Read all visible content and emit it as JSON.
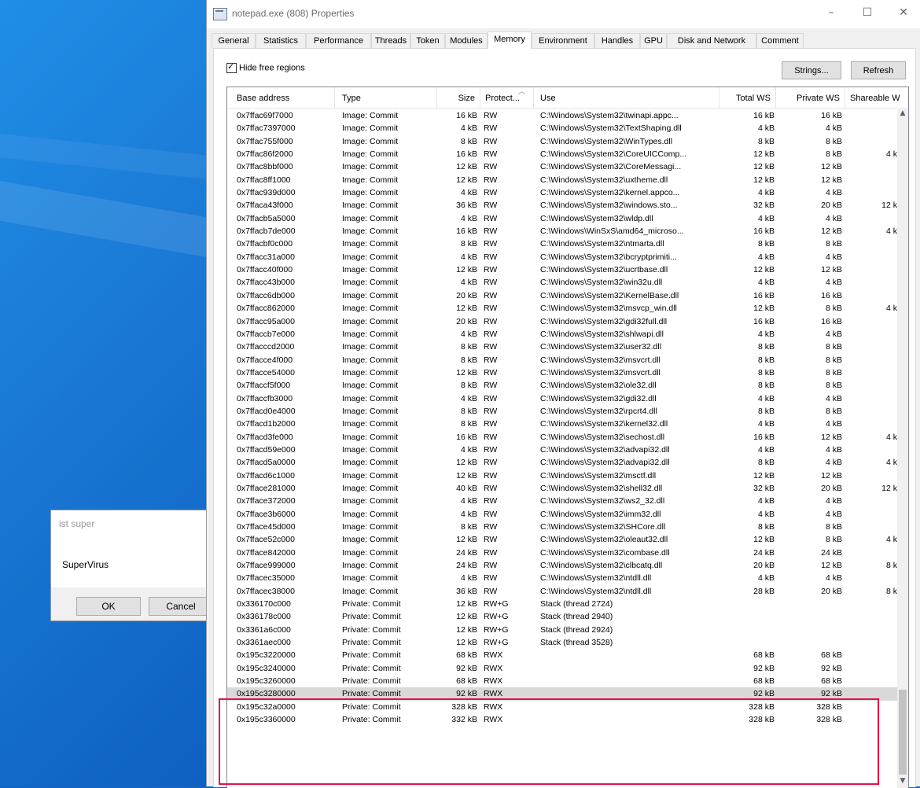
{
  "window": {
    "title": "notepad.exe (808) Properties",
    "tabs": [
      "General",
      "Statistics",
      "Performance",
      "Threads",
      "Token",
      "Modules",
      "Memory",
      "Environment",
      "Handles",
      "GPU",
      "Disk and Network",
      "Comment"
    ],
    "active_tab": "Memory"
  },
  "toolbar": {
    "hide_free_label": "Hide free regions",
    "hide_free_checked": true,
    "strings_label": "Strings...",
    "refresh_label": "Refresh"
  },
  "columns": {
    "base": "Base address",
    "type": "Type",
    "size": "Size",
    "protect": "Protect...",
    "use": "Use",
    "total_ws": "Total WS",
    "private_ws": "Private WS",
    "shareable_ws": "Shareable W"
  },
  "rows": [
    [
      "0x7ffac69f7000",
      "Image: Commit",
      "16 kB",
      "RW",
      "C:\\Windows\\System32\\twinapi.appc...",
      "16 kB",
      "16 kB",
      ""
    ],
    [
      "0x7ffac7397000",
      "Image: Commit",
      "4 kB",
      "RW",
      "C:\\Windows\\System32\\TextShaping.dll",
      "4 kB",
      "4 kB",
      ""
    ],
    [
      "0x7ffac755f000",
      "Image: Commit",
      "8 kB",
      "RW",
      "C:\\Windows\\System32\\WinTypes.dll",
      "8 kB",
      "8 kB",
      ""
    ],
    [
      "0x7ffac86f2000",
      "Image: Commit",
      "16 kB",
      "RW",
      "C:\\Windows\\System32\\CoreUICComp...",
      "12 kB",
      "8 kB",
      "4 k"
    ],
    [
      "0x7ffac8bbf000",
      "Image: Commit",
      "12 kB",
      "RW",
      "C:\\Windows\\System32\\CoreMessagi...",
      "12 kB",
      "12 kB",
      ""
    ],
    [
      "0x7ffac8ff1000",
      "Image: Commit",
      "12 kB",
      "RW",
      "C:\\Windows\\System32\\uxtheme.dll",
      "12 kB",
      "12 kB",
      ""
    ],
    [
      "0x7ffac939d000",
      "Image: Commit",
      "4 kB",
      "RW",
      "C:\\Windows\\System32\\kernel.appco...",
      "4 kB",
      "4 kB",
      ""
    ],
    [
      "0x7ffaca43f000",
      "Image: Commit",
      "36 kB",
      "RW",
      "C:\\Windows\\System32\\windows.sto...",
      "32 kB",
      "20 kB",
      "12 k"
    ],
    [
      "0x7ffacb5a5000",
      "Image: Commit",
      "4 kB",
      "RW",
      "C:\\Windows\\System32\\wldp.dll",
      "4 kB",
      "4 kB",
      ""
    ],
    [
      "0x7ffacb7de000",
      "Image: Commit",
      "16 kB",
      "RW",
      "C:\\Windows\\WinSxS\\amd64_microso...",
      "16 kB",
      "12 kB",
      "4 k"
    ],
    [
      "0x7ffacbf0c000",
      "Image: Commit",
      "8 kB",
      "RW",
      "C:\\Windows\\System32\\ntmarta.dll",
      "8 kB",
      "8 kB",
      ""
    ],
    [
      "0x7ffacc31a000",
      "Image: Commit",
      "4 kB",
      "RW",
      "C:\\Windows\\System32\\bcryptprimiti...",
      "4 kB",
      "4 kB",
      ""
    ],
    [
      "0x7ffacc40f000",
      "Image: Commit",
      "12 kB",
      "RW",
      "C:\\Windows\\System32\\ucrtbase.dll",
      "12 kB",
      "12 kB",
      ""
    ],
    [
      "0x7ffacc43b000",
      "Image: Commit",
      "4 kB",
      "RW",
      "C:\\Windows\\System32\\win32u.dll",
      "4 kB",
      "4 kB",
      ""
    ],
    [
      "0x7ffacc6db000",
      "Image: Commit",
      "20 kB",
      "RW",
      "C:\\Windows\\System32\\KernelBase.dll",
      "16 kB",
      "16 kB",
      ""
    ],
    [
      "0x7ffacc862000",
      "Image: Commit",
      "12 kB",
      "RW",
      "C:\\Windows\\System32\\msvcp_win.dll",
      "12 kB",
      "8 kB",
      "4 k"
    ],
    [
      "0x7ffacc95a000",
      "Image: Commit",
      "20 kB",
      "RW",
      "C:\\Windows\\System32\\gdi32full.dll",
      "16 kB",
      "16 kB",
      ""
    ],
    [
      "0x7ffaccb7e000",
      "Image: Commit",
      "4 kB",
      "RW",
      "C:\\Windows\\System32\\shlwapi.dll",
      "4 kB",
      "4 kB",
      ""
    ],
    [
      "0x7ffacccd2000",
      "Image: Commit",
      "8 kB",
      "RW",
      "C:\\Windows\\System32\\user32.dll",
      "8 kB",
      "8 kB",
      ""
    ],
    [
      "0x7ffacce4f000",
      "Image: Commit",
      "8 kB",
      "RW",
      "C:\\Windows\\System32\\msvcrt.dll",
      "8 kB",
      "8 kB",
      ""
    ],
    [
      "0x7ffacce54000",
      "Image: Commit",
      "12 kB",
      "RW",
      "C:\\Windows\\System32\\msvcrt.dll",
      "8 kB",
      "8 kB",
      ""
    ],
    [
      "0x7ffaccf5f000",
      "Image: Commit",
      "8 kB",
      "RW",
      "C:\\Windows\\System32\\ole32.dll",
      "8 kB",
      "8 kB",
      ""
    ],
    [
      "0x7ffaccfb3000",
      "Image: Commit",
      "4 kB",
      "RW",
      "C:\\Windows\\System32\\gdi32.dll",
      "4 kB",
      "4 kB",
      ""
    ],
    [
      "0x7ffacd0e4000",
      "Image: Commit",
      "8 kB",
      "RW",
      "C:\\Windows\\System32\\rpcrt4.dll",
      "8 kB",
      "8 kB",
      ""
    ],
    [
      "0x7ffacd1b2000",
      "Image: Commit",
      "8 kB",
      "RW",
      "C:\\Windows\\System32\\kernel32.dll",
      "4 kB",
      "4 kB",
      ""
    ],
    [
      "0x7ffacd3fe000",
      "Image: Commit",
      "16 kB",
      "RW",
      "C:\\Windows\\System32\\sechost.dll",
      "16 kB",
      "12 kB",
      "4 k"
    ],
    [
      "0x7ffacd59e000",
      "Image: Commit",
      "4 kB",
      "RW",
      "C:\\Windows\\System32\\advapi32.dll",
      "4 kB",
      "4 kB",
      ""
    ],
    [
      "0x7ffacd5a0000",
      "Image: Commit",
      "12 kB",
      "RW",
      "C:\\Windows\\System32\\advapi32.dll",
      "8 kB",
      "4 kB",
      "4 k"
    ],
    [
      "0x7ffacd6c1000",
      "Image: Commit",
      "12 kB",
      "RW",
      "C:\\Windows\\System32\\msctf.dll",
      "12 kB",
      "12 kB",
      ""
    ],
    [
      "0x7fface281000",
      "Image: Commit",
      "40 kB",
      "RW",
      "C:\\Windows\\System32\\shell32.dll",
      "32 kB",
      "20 kB",
      "12 k"
    ],
    [
      "0x7fface372000",
      "Image: Commit",
      "4 kB",
      "RW",
      "C:\\Windows\\System32\\ws2_32.dll",
      "4 kB",
      "4 kB",
      ""
    ],
    [
      "0x7fface3b6000",
      "Image: Commit",
      "4 kB",
      "RW",
      "C:\\Windows\\System32\\imm32.dll",
      "4 kB",
      "4 kB",
      ""
    ],
    [
      "0x7fface45d000",
      "Image: Commit",
      "8 kB",
      "RW",
      "C:\\Windows\\System32\\SHCore.dll",
      "8 kB",
      "8 kB",
      ""
    ],
    [
      "0x7fface52c000",
      "Image: Commit",
      "12 kB",
      "RW",
      "C:\\Windows\\System32\\oleaut32.dll",
      "12 kB",
      "8 kB",
      "4 k"
    ],
    [
      "0x7fface842000",
      "Image: Commit",
      "24 kB",
      "RW",
      "C:\\Windows\\System32\\combase.dll",
      "24 kB",
      "24 kB",
      ""
    ],
    [
      "0x7fface999000",
      "Image: Commit",
      "24 kB",
      "RW",
      "C:\\Windows\\System32\\clbcatq.dll",
      "20 kB",
      "12 kB",
      "8 k"
    ],
    [
      "0x7ffacec35000",
      "Image: Commit",
      "4 kB",
      "RW",
      "C:\\Windows\\System32\\ntdll.dll",
      "4 kB",
      "4 kB",
      ""
    ],
    [
      "0x7ffacec38000",
      "Image: Commit",
      "36 kB",
      "RW",
      "C:\\Windows\\System32\\ntdll.dll",
      "28 kB",
      "20 kB",
      "8 k"
    ],
    [
      "0x336170c000",
      "Private: Commit",
      "12 kB",
      "RW+G",
      "Stack (thread 2724)",
      "",
      "",
      ""
    ],
    [
      "0x336178c000",
      "Private: Commit",
      "12 kB",
      "RW+G",
      "Stack (thread 2940)",
      "",
      "",
      ""
    ],
    [
      "0x3361a6c000",
      "Private: Commit",
      "12 kB",
      "RW+G",
      "Stack (thread 2924)",
      "",
      "",
      ""
    ],
    [
      "0x3361aec000",
      "Private: Commit",
      "12 kB",
      "RW+G",
      "Stack (thread 3528)",
      "",
      "",
      ""
    ],
    [
      "0x195c3220000",
      "Private: Commit",
      "68 kB",
      "RWX",
      "",
      "68 kB",
      "68 kB",
      ""
    ],
    [
      "0x195c3240000",
      "Private: Commit",
      "92 kB",
      "RWX",
      "",
      "92 kB",
      "92 kB",
      ""
    ],
    [
      "0x195c3260000",
      "Private: Commit",
      "68 kB",
      "RWX",
      "",
      "68 kB",
      "68 kB",
      ""
    ],
    [
      "0x195c3280000",
      "Private: Commit",
      "92 kB",
      "RWX",
      "",
      "92 kB",
      "92 kB",
      ""
    ],
    [
      "0x195c32a0000",
      "Private: Commit",
      "328 kB",
      "RWX",
      "",
      "328 kB",
      "328 kB",
      ""
    ],
    [
      "0x195c3360000",
      "Private: Commit",
      "332 kB",
      "RWX",
      "",
      "328 kB",
      "328 kB",
      ""
    ]
  ],
  "selected_row": 45,
  "msgbox": {
    "title": "ist super",
    "message": "SuperVirus",
    "ok_label": "OK",
    "cancel_label": "Cancel"
  },
  "colors": {
    "highlight_border": "#e0144a",
    "selected_row": "#d9d9d9"
  }
}
